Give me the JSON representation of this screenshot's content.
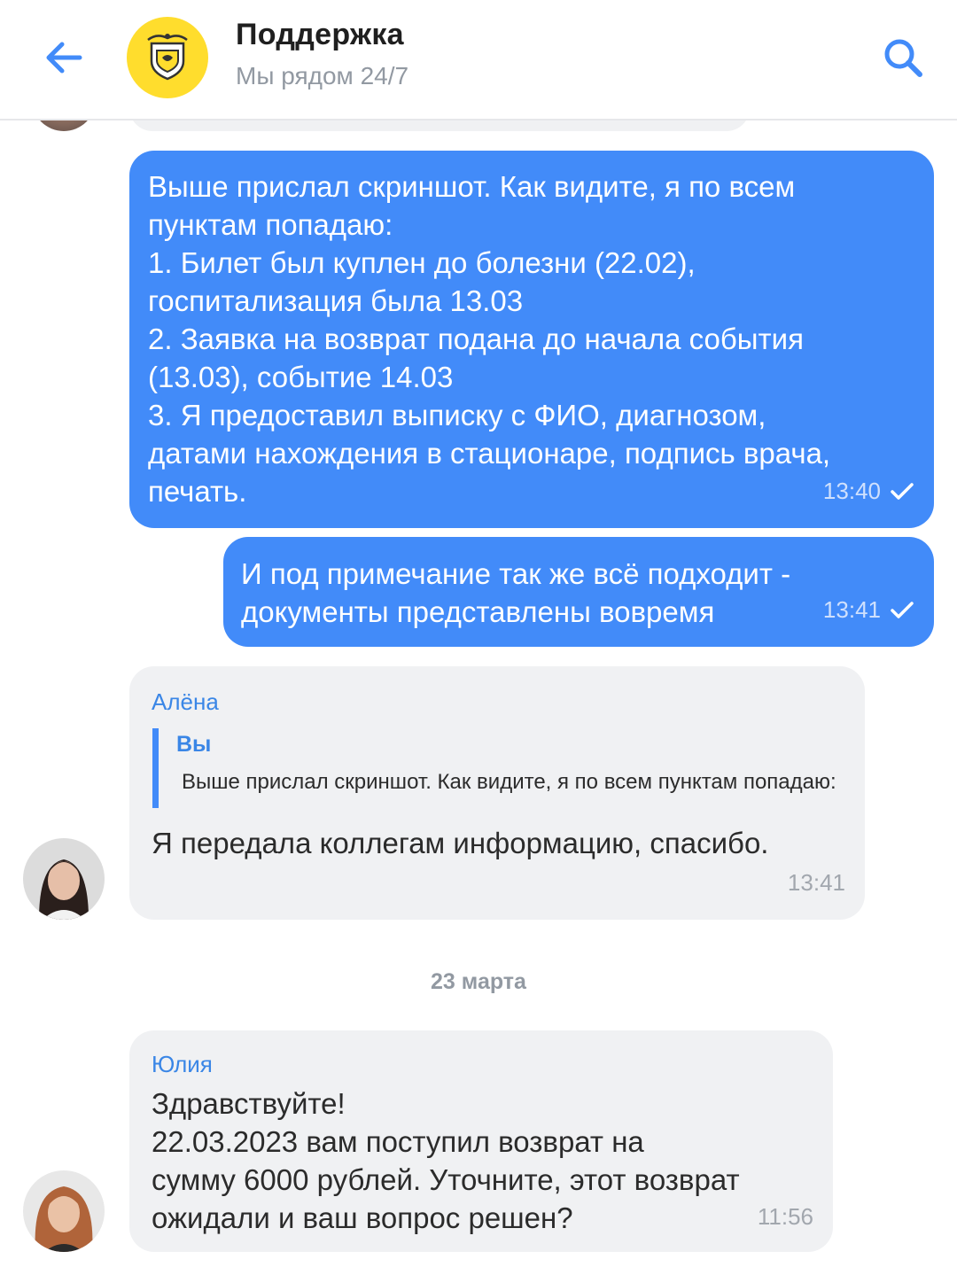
{
  "header": {
    "title": "Поддержка",
    "subtitle": "Мы рядом 24/7",
    "back_icon": "arrow-left-icon",
    "search_icon": "search-icon",
    "logo_icon": "bank-emblem-logo",
    "accent": "#428bf9",
    "logo_color": "#ffdd2d"
  },
  "messages": [
    {
      "type": "outgoing",
      "text": "Выше прислал скриншот. Как видите, я по всем\nпунктам попадаю:\n1. Билет был куплен до болезни (22.02),\nгоспитализация была 13.03\n2. Заявка на возврат подана до начала события\n(13.03), событие 14.03\n3. Я предоставил выписку с ФИО, диагнозом,\nдатами нахождения в стационаре, подпись врача,\nпечать.",
      "time": "13:40"
    },
    {
      "type": "outgoing",
      "text": "И под примечание так же всё подходит -\nдокументы представлены вовремя",
      "time": "13:41"
    },
    {
      "type": "incoming",
      "sender": "Алёна",
      "quote_author": "Вы",
      "quote_text": "Выше прислал скриншот. Как видите, я по всем пунктам попадаю:",
      "text": "Я передала коллегам информацию, спасибо.",
      "time": "13:41"
    },
    {
      "type": "incoming",
      "sender": "Юлия",
      "text": "Здравствуйте!\n22.03.2023 вам поступил возврат на\nсумму 6000 рублей. Уточните, этот возврат\nожидали и ваш вопрос решен?",
      "time": "11:56"
    }
  ],
  "date_separator": "23 марта",
  "status_icon": "check-icon"
}
